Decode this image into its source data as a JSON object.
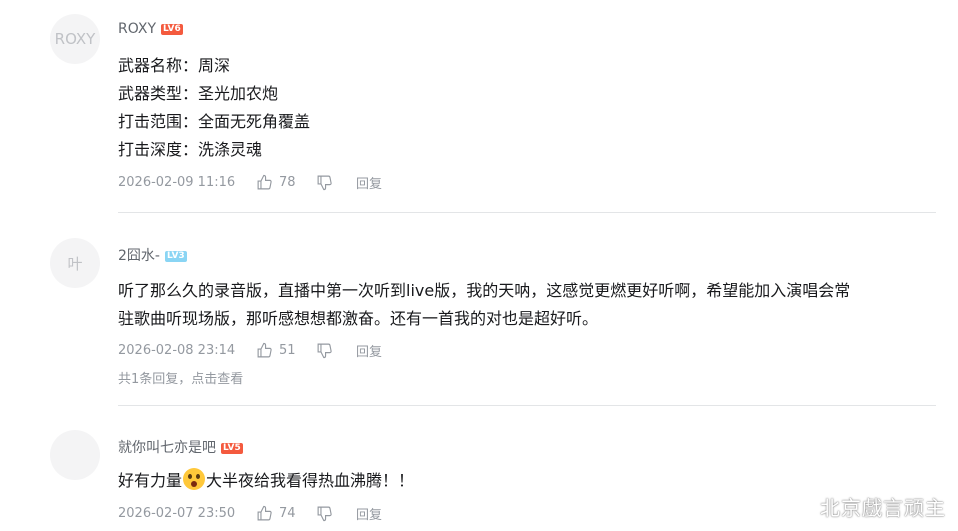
{
  "comments": [
    {
      "avatar_text": "ROXY",
      "username": "ROXY",
      "level": "LV6",
      "lines": [
        "武器名称：周深",
        "武器类型：圣光加农炮",
        "打击范围：全面无死角覆盖",
        "打击深度：洗涤灵魂"
      ],
      "time": "2026-02-09 11:16",
      "likes": "78",
      "reply_label": "回复"
    },
    {
      "avatar_text": "叶",
      "username": "2囧水-",
      "level": "LV3",
      "lines": [
        "听了那么久的录音版，直播中第一次听到live版，我的天呐，这感觉更燃更好听啊，希望能加入演唱会常",
        "驻歌曲听现场版，那听感想想都激奋。还有一首我的对也是超好听。"
      ],
      "time": "2026-02-08 23:14",
      "likes": "51",
      "reply_label": "回复",
      "sub_replies": "共1条回复，点击查看"
    },
    {
      "avatar_text": "",
      "username": "就你叫七亦是吧",
      "level": "LV5",
      "text_before": "好有力量",
      "text_after": "大半夜给我看得热血沸腾！！",
      "time": "2026-02-07 23:50",
      "likes": "74",
      "reply_label": "回复"
    }
  ],
  "watermark": "北京戲言顽主",
  "colors": {
    "level_red": "#f45a3e",
    "level_blue": "#8ad5f4",
    "meta_gray": "#9499a0"
  }
}
